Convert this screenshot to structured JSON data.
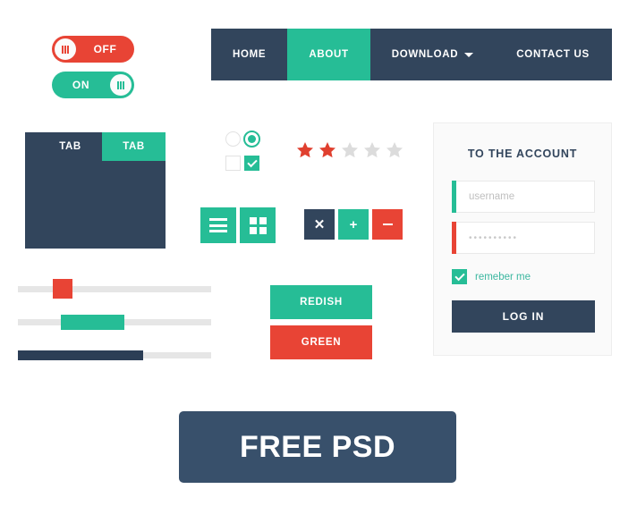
{
  "colors": {
    "teal": "#26bd96",
    "red": "#e84435",
    "dark": "#32455c",
    "banner_dark": "#38506b",
    "track_grey": "#e6e6e6",
    "card_bg": "#fafafa"
  },
  "toggles": [
    {
      "name": "toggle-off",
      "label": "OFF",
      "state": "off",
      "color": "#e84435"
    },
    {
      "name": "toggle-on",
      "label": "ON",
      "state": "on",
      "color": "#26bd96"
    }
  ],
  "navbar": {
    "items": [
      {
        "label": "HOME",
        "active": false,
        "has_caret": false
      },
      {
        "label": "ABOUT",
        "active": true,
        "has_caret": false
      },
      {
        "label": "DOWNLOAD",
        "active": false,
        "has_caret": true
      },
      {
        "label": "CONTACT US",
        "active": false,
        "has_caret": false
      }
    ]
  },
  "tabs": [
    {
      "label": "TAB",
      "active": false
    },
    {
      "label": "TAB",
      "active": true
    }
  ],
  "radios": [
    {
      "selected": false
    },
    {
      "selected": true
    }
  ],
  "checkboxes": [
    {
      "checked": false
    },
    {
      "checked": true
    }
  ],
  "rating": {
    "value": 2,
    "max": 5,
    "filled_color": "#e0402f",
    "empty_color": "#dcdcdc"
  },
  "icon_buttons": [
    {
      "icon": "list-icon",
      "color": "#26bd96"
    },
    {
      "icon": "grid-icon",
      "color": "#26bd96"
    },
    {
      "icon": "close-icon",
      "label": "✕",
      "color": "#32455c"
    },
    {
      "icon": "plus-icon",
      "label": "+",
      "color": "#26bd96"
    },
    {
      "icon": "minus-icon",
      "label": "−",
      "color": "#e84435"
    }
  ],
  "sliders": [
    {
      "name": "slider-red-handle",
      "handle_percent": 18,
      "fill_percent": 0,
      "style": "handle",
      "color": "#e84435"
    },
    {
      "name": "slider-teal-range",
      "start_percent": 22,
      "end_percent": 55,
      "style": "range",
      "color": "#26bd96"
    },
    {
      "name": "slider-dark-progress",
      "fill_percent": 65,
      "style": "progress",
      "color": "#2c3e56"
    }
  ],
  "color_buttons": [
    {
      "label": "REDISH",
      "color": "#26bd96"
    },
    {
      "label": "GREEN",
      "color": "#e84435"
    }
  ],
  "login": {
    "title": "TO THE ACCOUNT",
    "username": {
      "placeholder": "username",
      "value": "",
      "accent": "#26bd96"
    },
    "password": {
      "value": "••••••••••",
      "accent": "#e84435"
    },
    "remember": {
      "label": "remeber me",
      "checked": true
    },
    "submit_label": "LOG IN"
  },
  "banner": {
    "label": "FREE PSD"
  }
}
